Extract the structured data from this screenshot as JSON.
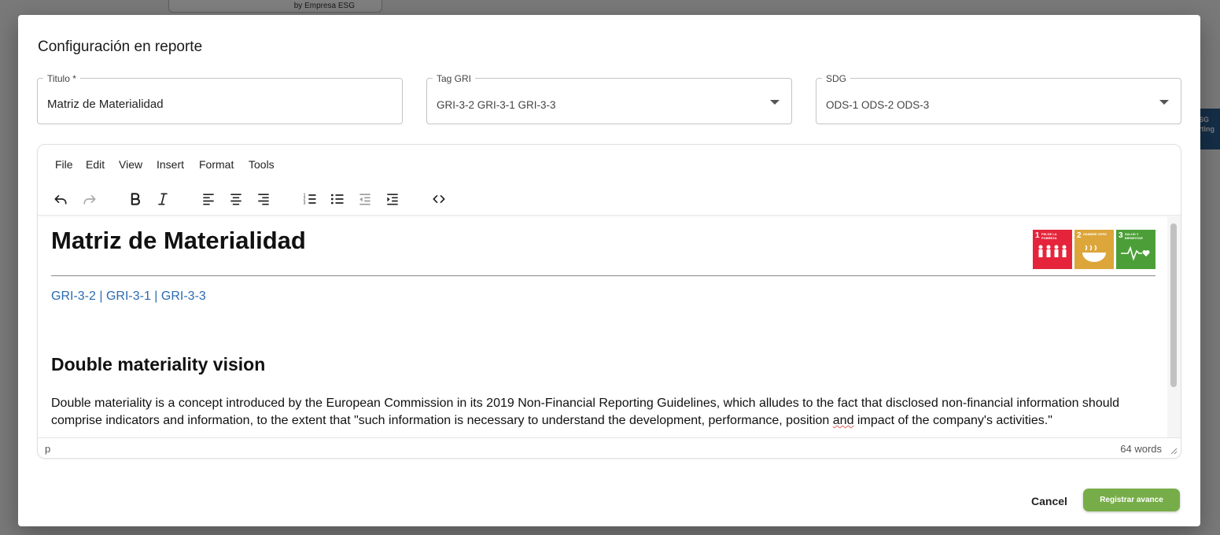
{
  "background": {
    "top_card_caption": "by Empresa ESG",
    "side_tab_label_line1": "SG",
    "side_tab_label_line2": "rting"
  },
  "modal": {
    "title": "Configuración en reporte",
    "fields": {
      "titulo": {
        "label": "Titulo *",
        "value": "Matriz de Materialidad"
      },
      "tag_gri": {
        "label": "Tag GRI",
        "value": "GRI-3-2 GRI-3-1 GRI-3-3"
      },
      "sdg": {
        "label": "SDG",
        "value": "ODS-1 ODS-2 ODS-3"
      }
    },
    "editor": {
      "menu": [
        "File",
        "Edit",
        "View",
        "Insert",
        "Format",
        "Tools"
      ],
      "toolbar_icons": [
        "undo-icon",
        "redo-icon",
        "bold-icon",
        "italic-icon",
        "align-left-icon",
        "align-center-icon",
        "align-right-icon",
        "numbered-list-icon",
        "bullet-list-icon",
        "outdent-icon",
        "indent-icon",
        "source-code-icon"
      ],
      "content": {
        "heading": "Matriz de Materialidad",
        "sdg_badges": [
          {
            "number": "1",
            "label": "FIN DE LA POBREZA",
            "color": "#e5243b"
          },
          {
            "number": "2",
            "label": "HAMBRE CERO",
            "color": "#dda63a"
          },
          {
            "number": "3",
            "label": "SALUD Y BIENESTAR",
            "color": "#4c9f38"
          }
        ],
        "gri_line": "GRI-3-2 | GRI-3-1 | GRI-3-3",
        "subheading": "Double materiality vision",
        "paragraph_part1": "Double materiality is a concept introduced by the European Commission in its 2019 Non-Financial Reporting Guidelines, which alludes to the fact that disclosed non-financial information should comprise indicators and information, to the extent that \"such information is necessary to understand the development, performance, position ",
        "paragraph_spell": "and",
        "paragraph_part2": " impact of the company's activities.\""
      },
      "status": {
        "path": "p",
        "word_count": "64 words"
      }
    },
    "actions": {
      "cancel": "Cancel",
      "submit": "Registrar avance"
    },
    "colors": {
      "primary": "#77ad48",
      "link": "#2a6bb0"
    }
  }
}
